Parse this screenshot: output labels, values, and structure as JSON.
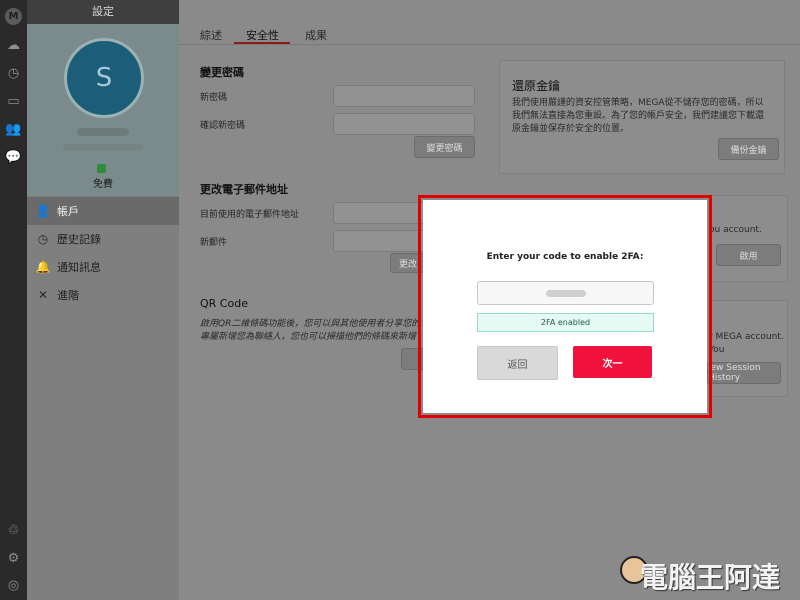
{
  "sidebar": {
    "title": "設定",
    "plan": "免費",
    "items": [
      {
        "label": "帳戶",
        "icon": "user-icon"
      },
      {
        "label": "歷史記錄",
        "icon": "clock-icon"
      },
      {
        "label": "通知訊息",
        "icon": "bell-icon"
      },
      {
        "label": "進階",
        "icon": "tools-icon"
      }
    ],
    "avatar_letter": "S"
  },
  "tabs": [
    "綜述",
    "安全性",
    "成果"
  ],
  "password": {
    "title": "變更密碼",
    "new_label": "新密碼",
    "confirm_label": "確認新密碼",
    "button": "變更密碼"
  },
  "email": {
    "title": "更改電子郵件地址",
    "current_label": "目前使用的電子郵件地址",
    "new_label": "新郵件",
    "button_partial": "更改"
  },
  "recovery": {
    "title": "還原金鑰",
    "text": "我們使用嚴謹的資安控管策略，MEGA從不儲存您的密碼，所以我們無法直接為您重設。為了您的帳戶安全，我們建議您下載還原金鑰並保存於安全的位置。",
    "button": "備份金鑰"
  },
  "twofa_card": {
    "text_partial": "ou account.",
    "button": "啟用"
  },
  "qr": {
    "title": "QR Code",
    "text": "啟用QR二維條碼功能後，您可以與其他使用者分享您的專屬新增您為聯絡人，您也可以掃描他們的條碼來新增其他使用"
  },
  "session": {
    "text_partial": "r MEGA account. You",
    "button_partial": "iew Session History"
  },
  "modal": {
    "title": "Enter your code to enable 2FA:",
    "status": "2FA enabled",
    "back": "返回",
    "next": "次一"
  },
  "watermark": {
    "text": "電腦王阿達"
  }
}
